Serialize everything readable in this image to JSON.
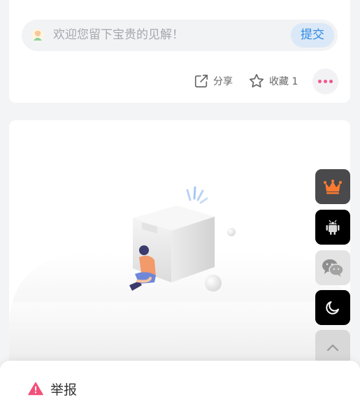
{
  "comment": {
    "placeholder": "欢迎您留下宝贵的见解！",
    "submit_label": "提交"
  },
  "actions": {
    "share_label": "分享",
    "favorite_label": "收藏 1"
  },
  "floating_toolbar": [
    {
      "name": "vip-crown",
      "icon": "crown-icon"
    },
    {
      "name": "android-app",
      "icon": "android-icon"
    },
    {
      "name": "wechat",
      "icon": "wechat-icon"
    },
    {
      "name": "dark-mode",
      "icon": "moon-icon"
    },
    {
      "name": "back-to-top",
      "icon": "chevron-up-icon"
    }
  ],
  "sheet": {
    "report_label": "举报"
  },
  "colors": {
    "accent_blue": "#2f8ae6",
    "more_dots": "#f2558e",
    "report_icon": "#f2507a",
    "crown": "#ff7a2f"
  }
}
